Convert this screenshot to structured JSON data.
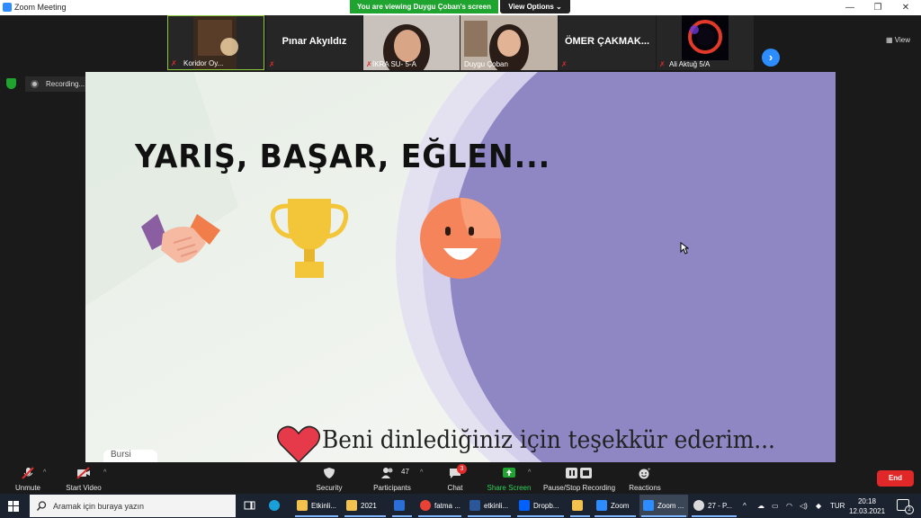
{
  "window": {
    "title": "Zoom Meeting"
  },
  "share_banner": {
    "text": "You are viewing Duygu Çoban's screen",
    "view_options": "View Options"
  },
  "participants_strip": [
    {
      "name": "Koridor Oy...",
      "muted": true
    },
    {
      "name": "Pınar Akyıldız",
      "muted": true
    },
    {
      "name": "İKRA SU- 5-A",
      "muted": true
    },
    {
      "name": "Duygu Çoban",
      "muted": false
    },
    {
      "name": "ÖMER  ÇAKMAK...",
      "muted": true
    },
    {
      "name": "Ali Aktuğ 5/A",
      "muted": true
    }
  ],
  "view_button": "View",
  "recording": {
    "label": "Recording..."
  },
  "slide": {
    "title": "YARIŞ, BAŞAR, EĞLEN...",
    "footer": "Beni dinlediğiniz için teşekkür ederim...",
    "logo_text": "Bursi"
  },
  "toolbar": {
    "unmute": "Unmute",
    "start_video": "Start Video",
    "security": "Security",
    "participants": "Participants",
    "participants_count": "47",
    "chat": "Chat",
    "chat_badge": "3",
    "share_screen": "Share Screen",
    "pause_stop": "Pause/Stop Recording",
    "reactions": "Reactions",
    "end": "End"
  },
  "taskbar": {
    "search_placeholder": "Aramak için buraya yazın",
    "apps": [
      {
        "label": "Etkinli...",
        "color": "#f2c14e"
      },
      {
        "label": "2021",
        "color": "#f2c14e"
      },
      {
        "label": "",
        "color": "#2b6fd6"
      },
      {
        "label": "fatma ...",
        "color": "#e94235"
      },
      {
        "label": "etkinli...",
        "color": "#2b579a"
      },
      {
        "label": "Dropb...",
        "color": "#0061ff"
      },
      {
        "label": "",
        "color": "#f2c14e"
      },
      {
        "label": "Zoom",
        "color": "#2d8cff"
      },
      {
        "label": "Zoom ...",
        "color": "#2d8cff"
      },
      {
        "label": "27 - P...",
        "color": "#d9d9d9"
      }
    ],
    "language": "TUR",
    "time": "20:18",
    "date": "12.03.2021",
    "notifications": "2"
  },
  "colors": {
    "accent": "#2d8cff",
    "share_green": "#1fa52f",
    "end_red": "#e02828",
    "slide_purple": "#8f86c4"
  }
}
